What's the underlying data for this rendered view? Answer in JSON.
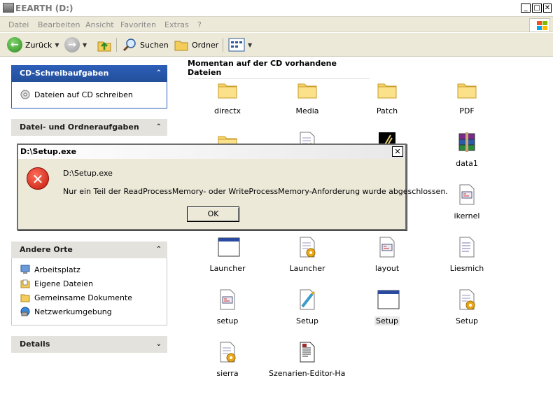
{
  "window": {
    "title": "EEARTH (D:)"
  },
  "menu": [
    "Datei",
    "Bearbeiten",
    "Ansicht",
    "Favoriten",
    "Extras",
    "?"
  ],
  "toolbar": {
    "back_label": "Zurück",
    "search_label": "Suchen",
    "folders_label": "Ordner"
  },
  "left": {
    "cd_tasks": {
      "title": "CD-Schreibaufgaben",
      "items": [
        "Dateien auf CD schreiben"
      ]
    },
    "file_tasks": {
      "title": "Datei- und Ordneraufgaben"
    },
    "other_places": {
      "title": "Andere Orte",
      "items": [
        "Arbeitsplatz",
        "Eigene Dateien",
        "Gemeinsame Dokumente",
        "Netzwerkumgebung"
      ]
    },
    "details": {
      "title": "Details"
    }
  },
  "main": {
    "section_title": "Momentan auf der CD vorhandene Dateien",
    "files": [
      {
        "label": "directx",
        "icon": "folder"
      },
      {
        "label": "Media",
        "icon": "folder"
      },
      {
        "label": "Patch",
        "icon": "folder"
      },
      {
        "label": "PDF",
        "icon": "folder"
      },
      {
        "label": "",
        "icon": "folder"
      },
      {
        "label": "",
        "icon": "setup-doc"
      },
      {
        "label": "",
        "icon": "app"
      },
      {
        "label": "data1",
        "icon": "winrar"
      },
      {
        "label": "ikernel",
        "icon": "ini"
      },
      {
        "label": "Launcher",
        "icon": "window"
      },
      {
        "label": "Launcher",
        "icon": "setup-doc"
      },
      {
        "label": "layout",
        "icon": "ini"
      },
      {
        "label": "Liesmich",
        "icon": "text"
      },
      {
        "label": "setup",
        "icon": "ini"
      },
      {
        "label": "Setup",
        "icon": "setup-pen"
      },
      {
        "label": "Setup",
        "icon": "window"
      },
      {
        "label": "Setup",
        "icon": "setup-doc"
      },
      {
        "label": "sierra",
        "icon": "setup-doc"
      },
      {
        "label": "Szenarien-Editor-Ha...",
        "icon": "word"
      }
    ]
  },
  "dialog": {
    "title": "D:\\Setup.exe",
    "line1": "D:\\Setup.exe",
    "line2": "Nur ein Teil der ReadProcessMemory- oder WriteProcessMemory-Anforderung wurde abgeschlossen.",
    "ok_label": "OK"
  }
}
